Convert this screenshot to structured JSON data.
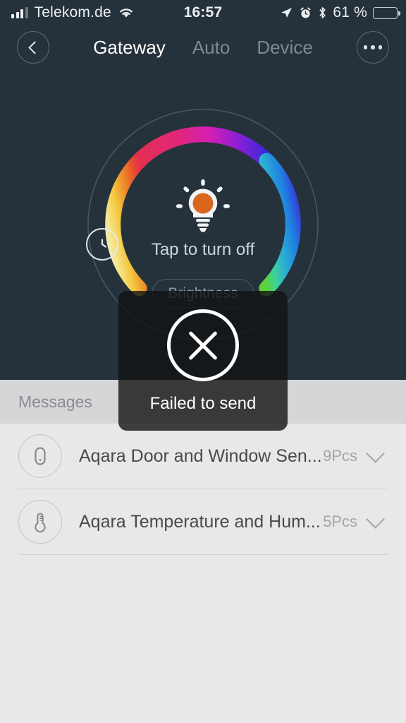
{
  "status_bar": {
    "carrier": "Telekom.de",
    "time": "16:57",
    "battery_text": "61 %",
    "battery_percent": 61,
    "icons": [
      "signal-bars-icon",
      "wifi-icon",
      "location-arrow-icon",
      "alarm-clock-icon",
      "bluetooth-icon",
      "battery-icon"
    ]
  },
  "navbar": {
    "back_icon": "chevron-left-icon",
    "more_icon": "ellipsis-icon",
    "tabs": [
      {
        "label": "Gateway",
        "active": true
      },
      {
        "label": "Auto",
        "active": false
      },
      {
        "label": "Device",
        "active": false
      }
    ]
  },
  "light_control": {
    "timer_icon": "clock-timer-icon",
    "bulb_icon": "light-bulb-icon",
    "bulb_color": "#d9661f",
    "power_label": "Tap to turn off",
    "brightness_label": "Brightness",
    "color_wheel": {
      "track_color": "#49565f",
      "gradient_stops": [
        "#f2efdc",
        "#f4e58a",
        "#f5c940",
        "#ef8c2a",
        "#e8522a",
        "#e0267a",
        "#d61fb4",
        "#8a1fd6",
        "#2a3fd8",
        "#1f7fe0",
        "#2aaed4",
        "#3dd39a",
        "#5ed23c"
      ],
      "start_angle_deg": -135,
      "sweep_deg": 270
    }
  },
  "messages": {
    "section_title": "Messages",
    "devices": [
      {
        "icon": "door-window-sensor-icon",
        "name": "Aqara Door and Window Sen...",
        "count": "9Pcs",
        "expand_icon": "chevron-down-icon"
      },
      {
        "icon": "temperature-humidity-sensor-icon",
        "name": "Aqara Temperature and Hum...",
        "count": "5Pcs",
        "expand_icon": "chevron-down-icon"
      }
    ]
  },
  "toast": {
    "icon": "circle-x-icon",
    "message": "Failed to send"
  }
}
